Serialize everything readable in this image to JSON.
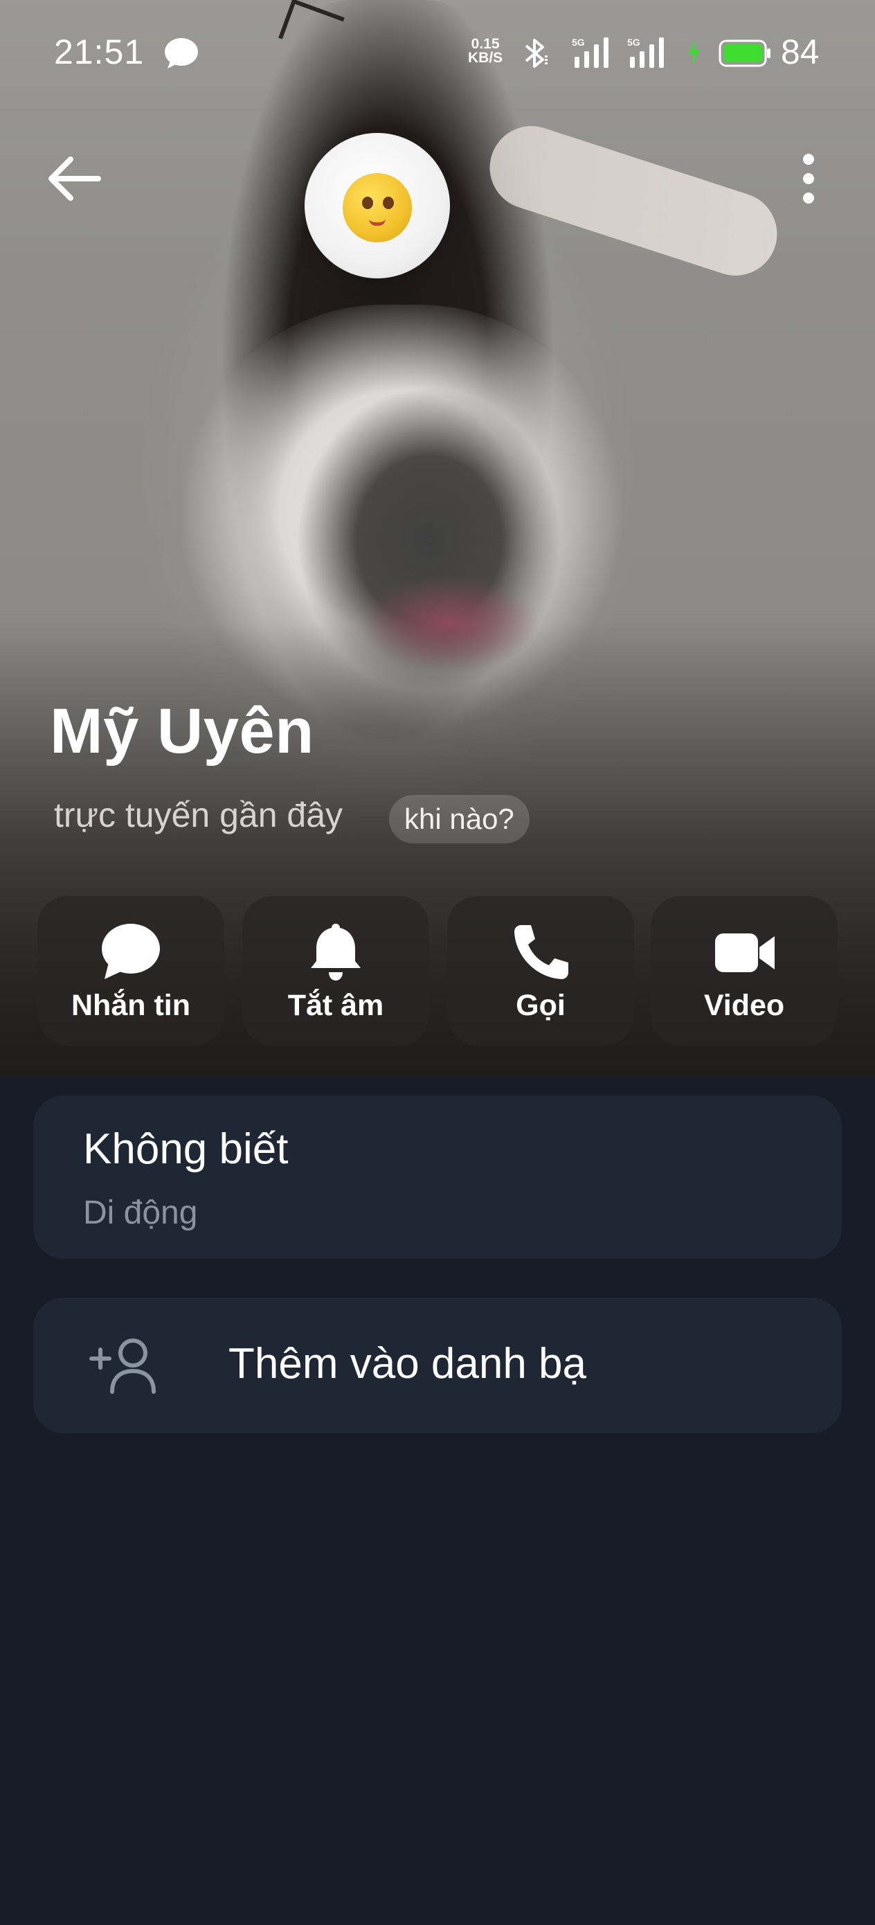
{
  "status_bar": {
    "time": "21:51",
    "net_rate_value": "0.15",
    "net_rate_unit": "KB/S",
    "network_1": "5G",
    "network_2": "5G",
    "battery_level": "84",
    "battery_color": "#3ddc2e",
    "icons": [
      "messenger-icon",
      "bluetooth-icon",
      "signal-icon",
      "signal-icon",
      "charging-icon",
      "battery-icon"
    ]
  },
  "top_bar": {
    "back_icon": "arrow-left-icon",
    "more_icon": "more-vertical-icon"
  },
  "profile": {
    "name": "Mỹ Uyên",
    "status": "trực tuyến gần đây",
    "when_chip": "khi nào?"
  },
  "actions": [
    {
      "label": "Nhắn tin",
      "icon": "chat-bubble-icon"
    },
    {
      "label": "Tắt âm",
      "icon": "bell-icon"
    },
    {
      "label": "Gọi",
      "icon": "phone-icon"
    },
    {
      "label": "Video",
      "icon": "video-camera-icon"
    }
  ],
  "phone_card": {
    "value": "Không biết",
    "label": "Di động"
  },
  "add_contact": {
    "label": "Thêm vào danh bạ",
    "icon": "add-person-icon"
  },
  "colors": {
    "background": "#161d27",
    "card": "#1e2733",
    "secondary_text": "#8a949f"
  }
}
